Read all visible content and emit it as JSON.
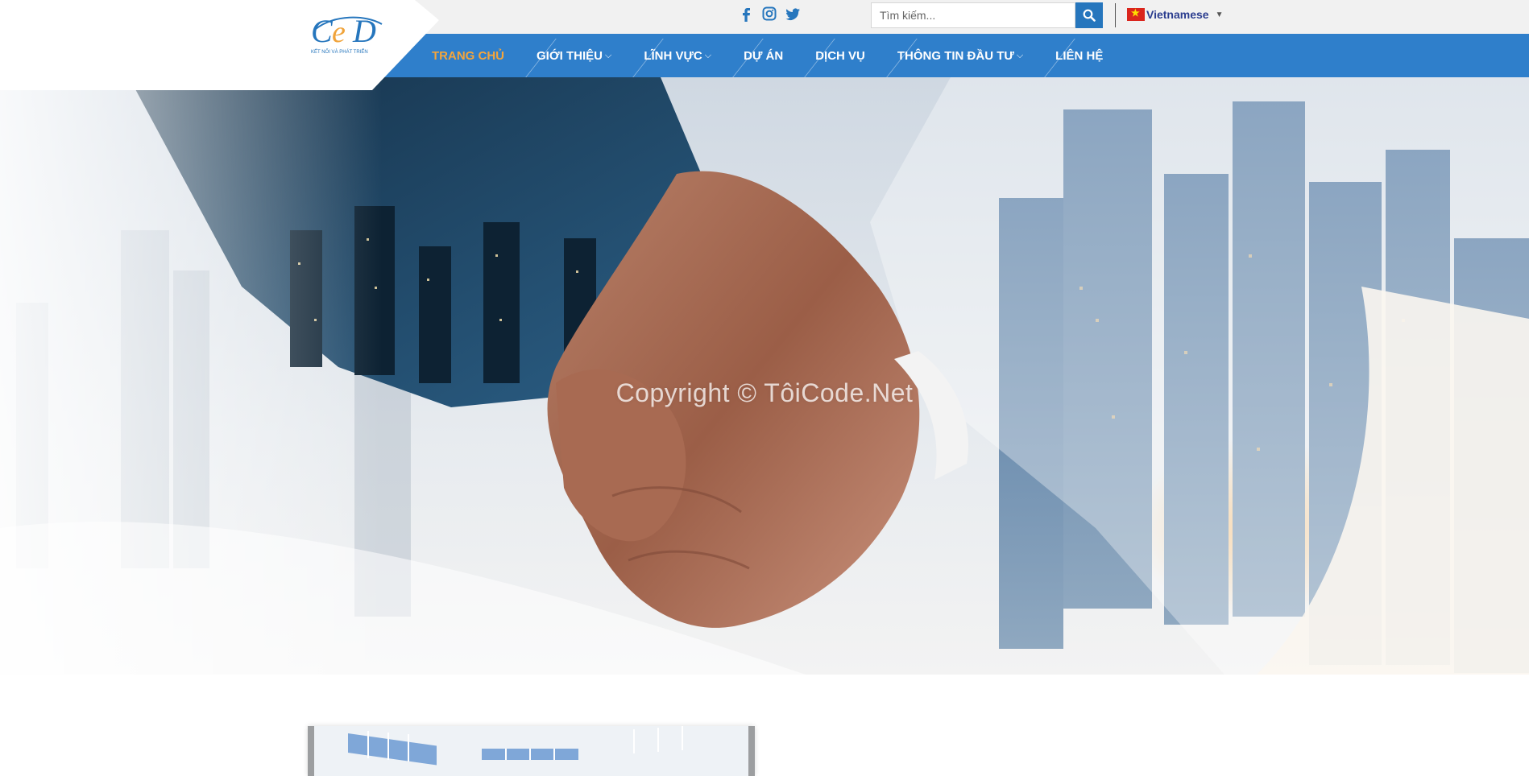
{
  "header": {
    "logo": {
      "text": "CED",
      "tagline": "KẾT NỐI VÀ PHÁT TRIỂN"
    },
    "social": [
      "facebook-icon",
      "instagram-icon",
      "twitter-icon"
    ],
    "search": {
      "placeholder": "Tìm kiếm...",
      "button_icon": "search-icon"
    },
    "language": {
      "label": "Vietnamese",
      "flag": "vietnam-flag-icon"
    }
  },
  "nav": {
    "items": [
      {
        "label": "TRANG CHỦ",
        "active": true,
        "dropdown": false
      },
      {
        "label": "GIỚI THIỆU",
        "active": false,
        "dropdown": true
      },
      {
        "label": "LĨNH VỰC",
        "active": false,
        "dropdown": true
      },
      {
        "label": "DỰ ÁN",
        "active": false,
        "dropdown": false
      },
      {
        "label": "DỊCH VỤ",
        "active": false,
        "dropdown": false
      },
      {
        "label": "THÔNG TIN ĐẦU TƯ",
        "active": false,
        "dropdown": true
      },
      {
        "label": "LIÊN HỆ",
        "active": false,
        "dropdown": false
      }
    ]
  },
  "hero": {
    "watermark": "Copyright © TôiCode.Net"
  },
  "colors": {
    "nav_bg": "#2f7fcb",
    "active": "#f5a53b",
    "search_button": "#2676bd",
    "topbar_bg": "#f1f1f1"
  }
}
